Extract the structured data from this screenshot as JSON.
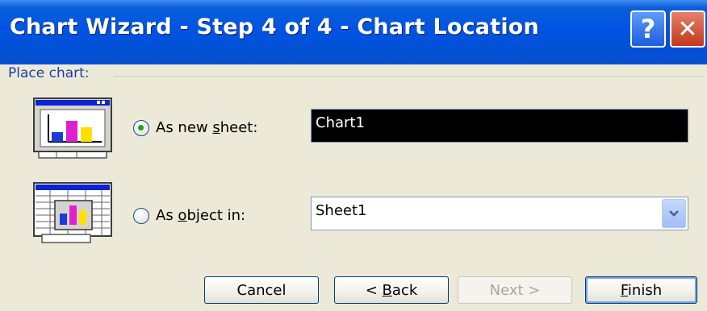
{
  "dialog": {
    "title": "Chart Wizard - Step 4 of 4 - Chart Location",
    "help_glyph": "?",
    "close_glyph": "✕"
  },
  "place_chart": {
    "label": "Place chart:",
    "new_sheet": {
      "label_pre": "As new ",
      "label_u": "s",
      "label_post": "heet:",
      "selected": true,
      "value": "Chart1"
    },
    "object_in": {
      "label_pre": "As ",
      "label_u": "o",
      "label_post": "bject in:",
      "selected": false,
      "value": "Sheet1"
    }
  },
  "buttons": {
    "cancel": "Cancel",
    "back_pre": "< ",
    "back_u": "B",
    "back_post": "ack",
    "next": "Next >",
    "finish_u": "F",
    "finish_post": "inish"
  },
  "icons": {
    "new_sheet": "chart-sheet-icon",
    "object_in": "embedded-chart-icon",
    "combo_arrow": "chevron-down-icon"
  },
  "colors": {
    "title_bar": "#0054e3",
    "window_bg": "#ece9d8",
    "group_label": "#1b3fa8",
    "close_button": "#c13a1c",
    "radio_dot": "#21a121"
  }
}
